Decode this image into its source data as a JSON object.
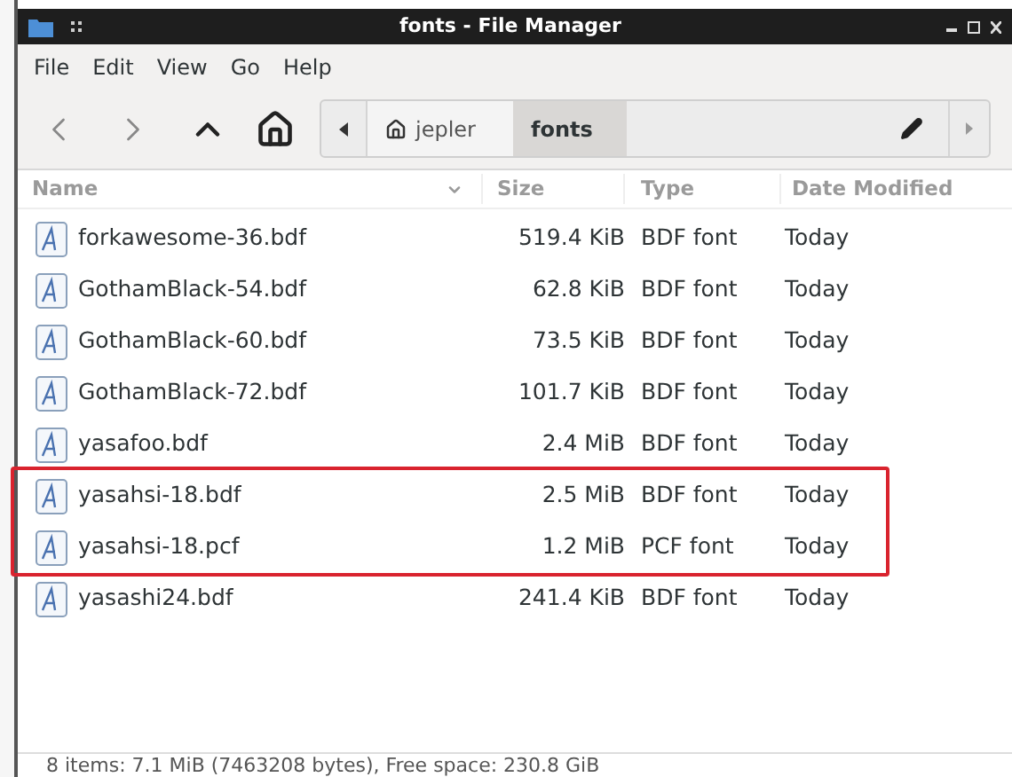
{
  "window": {
    "title": "fonts - File Manager"
  },
  "menu": [
    "File",
    "Edit",
    "View",
    "Go",
    "Help"
  ],
  "path": [
    {
      "label": "jepler",
      "kind": "home",
      "selected": false
    },
    {
      "label": "fonts",
      "kind": "folder",
      "selected": true
    }
  ],
  "table": {
    "columns": [
      "Name",
      "Size",
      "Type",
      "Date Modified"
    ],
    "rows": [
      {
        "name": "forkawesome-36.bdf",
        "size": "519.4 KiB",
        "type": "BDF font",
        "date": "Today",
        "highlighted": false
      },
      {
        "name": "GothamBlack-54.bdf",
        "size": "62.8 KiB",
        "type": "BDF font",
        "date": "Today",
        "highlighted": false
      },
      {
        "name": "GothamBlack-60.bdf",
        "size": "73.5 KiB",
        "type": "BDF font",
        "date": "Today",
        "highlighted": false
      },
      {
        "name": "GothamBlack-72.bdf",
        "size": "101.7 KiB",
        "type": "BDF font",
        "date": "Today",
        "highlighted": false
      },
      {
        "name": "yasafoo.bdf",
        "size": "2.4 MiB",
        "type": "BDF font",
        "date": "Today",
        "highlighted": false
      },
      {
        "name": "yasahsi-18.bdf",
        "size": "2.5 MiB",
        "type": "BDF font",
        "date": "Today",
        "highlighted": true
      },
      {
        "name": "yasahsi-18.pcf",
        "size": "1.2 MiB",
        "type": "PCF font",
        "date": "Today",
        "highlighted": true
      },
      {
        "name": "yasashi24.bdf",
        "size": "241.4 KiB",
        "type": "BDF font",
        "date": "Today",
        "highlighted": false
      }
    ]
  },
  "status_bar": "8 items: 7.1 MiB (7463208 bytes), Free space: 230.8 GiB"
}
